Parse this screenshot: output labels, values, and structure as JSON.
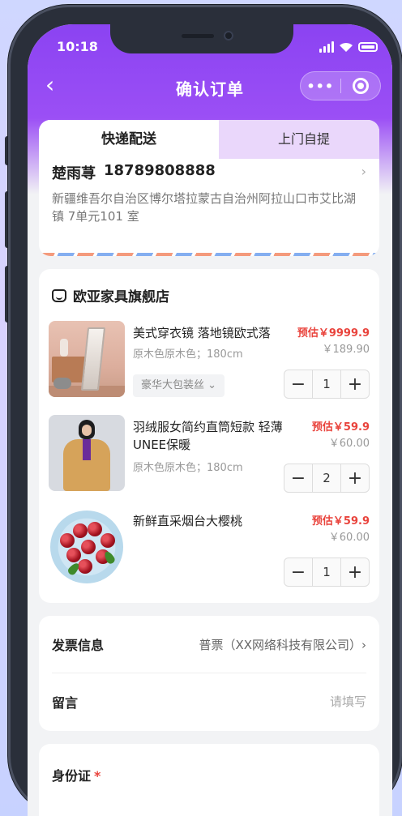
{
  "status_bar": {
    "time": "10:18"
  },
  "nav": {
    "back_glyph": "‹",
    "title": "确认订单",
    "more_glyph": "•••"
  },
  "tabs": {
    "express": "快递配送",
    "pickup": "上门自提"
  },
  "address": {
    "name": "楚雨荨",
    "phone": "18789808888",
    "detail": "新疆维吾尔自治区博尔塔拉蒙古自治州阿拉山口市艾比湖镇 7单元101 室",
    "chevron": "›"
  },
  "store": {
    "name": "欧亚家具旗舰店"
  },
  "items": [
    {
      "title": "美式穿衣镜 落地镜欧式落",
      "spec": "原木色原木色；180cm",
      "estimated": "预估￥9999.9",
      "original": "￥189.90",
      "package": "豪华大包装丝 ⌄",
      "qty": "1"
    },
    {
      "title": "羽绒服女简约直筒短款 轻薄 UNEE保暖",
      "spec": "原木色原木色；180cm",
      "estimated": "预估￥59.9",
      "original": "￥60.00",
      "qty": "2"
    },
    {
      "title": "新鲜直采烟台大樱桃",
      "estimated": "预估￥59.9",
      "original": "￥60.00",
      "qty": "1"
    }
  ],
  "stepper": {
    "minus": "−",
    "plus": "+"
  },
  "invoice": {
    "label": "发票信息",
    "value": "普票（XX网络科技有限公司）›"
  },
  "message": {
    "label": "留言",
    "placeholder": "请填写"
  },
  "id_card": {
    "label": "身份证",
    "required_mark": "*"
  },
  "colors": {
    "accent": "#8b43f2",
    "price_red": "#e9443d",
    "tab_inactive": "#ead7fb"
  }
}
